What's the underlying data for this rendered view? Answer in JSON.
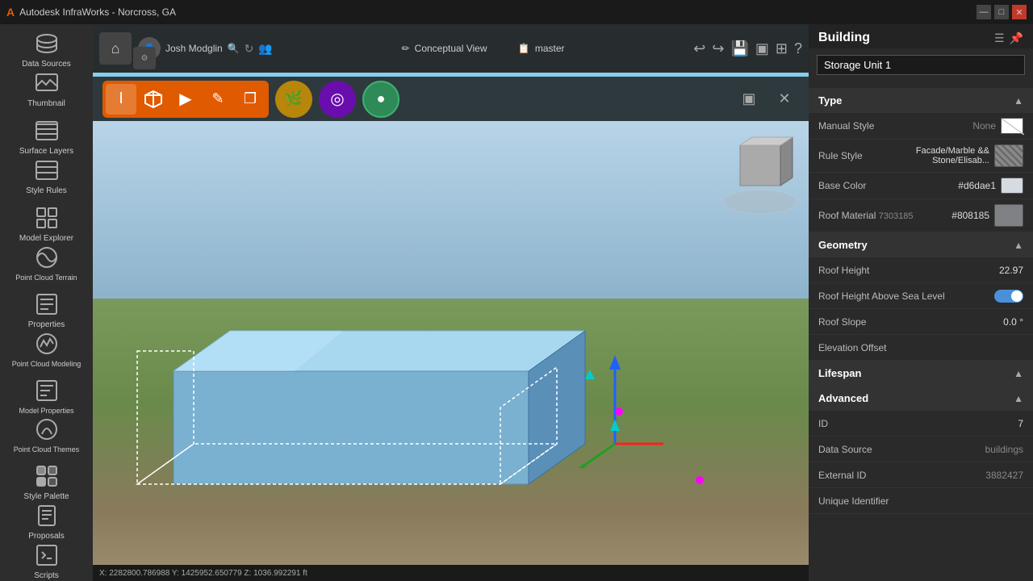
{
  "app": {
    "title": "Autodesk InfraWorks - Norcross, GA",
    "user": "Josh Modglin",
    "view": "Conceptual View",
    "branch": "master"
  },
  "titlebar": {
    "title": "Autodesk InfraWorks - Norcross, GA",
    "minimize": "—",
    "maximize": "□",
    "close": "✕"
  },
  "toolbar": {
    "home_icon": "⌂",
    "settings_icon": "⚙",
    "cursor_tool": "▶",
    "pencil_tool": "✎",
    "copy_tool": "❐",
    "tan_tool": "●",
    "purple_tool": "◉",
    "teal_tool": "◎",
    "view_icon": "▣",
    "wrench_icon": "✕"
  },
  "sidebar": {
    "items": [
      {
        "label": "Data Sources",
        "icon": "datasources"
      },
      {
        "label": "Thumbnail",
        "icon": "thumbnail"
      },
      {
        "label": "Surface Layers",
        "icon": "surface"
      },
      {
        "label": "Style Rules",
        "icon": "style"
      },
      {
        "label": "Model Explorer",
        "icon": "model"
      },
      {
        "label": "Point Cloud Terrain",
        "icon": "terrain"
      },
      {
        "label": "Properties",
        "icon": "properties"
      },
      {
        "label": "Point Cloud Modeling",
        "icon": "modeling"
      },
      {
        "label": "Model Properties",
        "icon": "modelprop"
      },
      {
        "label": "Point Cloud Themes",
        "icon": "themes"
      },
      {
        "label": "Style Palette",
        "icon": "palette"
      },
      {
        "label": "Proposals",
        "icon": "proposals"
      },
      {
        "label": "Scripts",
        "icon": "scripts"
      }
    ]
  },
  "viewport": {
    "status": "X: 2282800.786988  Y: 1425952.650779  Z: 1036.992291  ft"
  },
  "right_panel": {
    "section": "Building",
    "name": "Storage Unit 1",
    "type_section": {
      "label": "Type",
      "manual_style_label": "Manual Style",
      "manual_style_value": "None",
      "rule_style_label": "Rule Style",
      "rule_style_value": "Facade/Marble && Stone/Elisab...",
      "base_color_label": "Base Color",
      "base_color_value": "#d6dae1",
      "roof_material_label": "Roof Material",
      "roof_material_id": "7303185",
      "roof_material_value": "#808185"
    },
    "geometry_section": {
      "label": "Geometry",
      "roof_height_label": "Roof Height",
      "roof_height_value": "22.97",
      "roof_height_asl_label": "Roof Height Above Sea Level",
      "roof_height_asl_toggle": true,
      "roof_slope_label": "Roof Slope",
      "roof_slope_value": "0.0 °",
      "elevation_offset_label": "Elevation Offset",
      "elevation_offset_value": ""
    },
    "lifespan_section": {
      "label": "Lifespan"
    },
    "advanced_section": {
      "label": "Advanced",
      "id_label": "ID",
      "id_value": "7",
      "data_source_label": "Data Source",
      "data_source_value": "buildings",
      "external_id_label": "External ID",
      "external_id_value": "3882427",
      "unique_identifier_label": "Unique Identifier",
      "unique_identifier_value": ""
    }
  }
}
